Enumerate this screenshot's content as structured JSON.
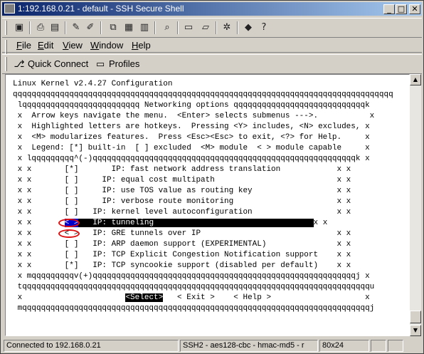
{
  "window": {
    "title": "1:192.168.0.21 - default - SSH Secure Shell",
    "minimize": "_",
    "maximize": "□",
    "close": "✕"
  },
  "toolbar": {
    "icons": [
      "save-icon",
      "print-icon",
      "print-preview-icon",
      "disconnect-icon",
      "connect-icon",
      "copy-icon",
      "paste-icon",
      "paste-alt-icon",
      "find-icon",
      "new-terminal-icon",
      "new-file-transfer-icon",
      "settings-icon",
      "help-book-icon",
      "context-help-icon"
    ],
    "glyphs": {
      "save": "▣",
      "print": "⎙",
      "preview": "▤",
      "disconnect": "✎",
      "connect": "✐",
      "copy": "⧉",
      "paste": "▦",
      "paste2": "▥",
      "find": "⌕",
      "terminal": "▭",
      "sftp": "▱",
      "settings": "✲",
      "book": "◆",
      "help": "?"
    }
  },
  "menu": {
    "items": [
      {
        "key": "F",
        "rest": "ile"
      },
      {
        "key": "E",
        "rest": "dit"
      },
      {
        "key": "V",
        "rest": "iew"
      },
      {
        "key": "W",
        "rest": "indow"
      },
      {
        "key": "H",
        "rest": "elp"
      }
    ]
  },
  "links": {
    "quick_connect": "Quick Connect",
    "profiles": "Profiles",
    "quick_glyph": "⎇",
    "profiles_glyph": "▭"
  },
  "terminal": {
    "l01": "Linux Kernel v2.4.27 Configuration",
    "l02": "qqqqqqqqqqqqqqqqqqqqqqqqqqqqqqqqqqqqqqqqqqqqqqqqqqqqqqqqqqqqqqqqqqqqqqqqqqqqqqqqq",
    "l03": " lqqqqqqqqqqqqqqqqqqqqqqqqq Networking options qqqqqqqqqqqqqqqqqqqqqqqqqqqqk",
    "l04": " x  Arrow keys navigate the menu.  <Enter> selects submenus --->.           x",
    "l05": " x  Highlighted letters are hotkeys.  Pressing <Y> includes, <N> excludes, x",
    "l06": " x  <M> modularizes features.  Press <Esc><Esc> to exit, <?> for Help.     x",
    "l07": " x  Legend: [*] built-in  [ ] excluded  <M> module  < > module capable     x",
    "l08": " x lqqqqqqqqq^(-)qqqqqqqqqqqqqqqqqqqqqqqqqqqqqqqqqqqqqqqqqqqqqqqqqqqqqqqqk x",
    "l09": " x x       [*]       IP: fast network address translation            x x",
    "l10": " x x       [ ]     IP: equal cost multipath                          x x",
    "l11": " x x       [ ]     IP: use TOS value as routing key                  x x",
    "l12": " x x       [ ]     IP: verbose route monitoring                      x x",
    "l13": " x x       [ ]   IP: kernel level autoconfiguration                  x x",
    "l14_pre": " x x       ",
    "l14_sel": "< >",
    "l14_text": "   IP: tunneling                                  ",
    "l14_post": "x x",
    "l15": " x x       < >   IP: GRE tunnels over IP                             x x",
    "l16": " x x       [ ]   IP: ARP daemon support (EXPERIMENTAL)               x x",
    "l17": " x x       [ ]   IP: TCP Explicit Congestion Notification support    x x",
    "l18": " x x       [*]   IP: TCP syncookie support (disabled per default)    x x",
    "l19": " x mqqqqqqqqqv(+)qqqqqqqqqqqqqqqqqqqqqqqqqqqqqqqqqqqqqqqqqqqqqqqqqqqqqqqqj x",
    "l20": " tqqqqqqqqqqqqqqqqqqqqqqqqqqqqqqqqqqqqqqqqqqqqqqqqqqqqqqqqqqqqqqqqqqqqqqqqqqu",
    "l21_pre": " x                      ",
    "l21_select": "<Select>",
    "l21_mid": "   < Exit >    < Help >                    ",
    "l21_post": "x",
    "l22": " mqqqqqqqqqqqqqqqqqqqqqqqqqqqqqqqqqqqqqqqqqqqqqqqqqqqqqqqqqqqqqqqqqqqqqqqqqqj"
  },
  "scrollbar": {
    "up": "▲",
    "down": "▼"
  },
  "status": {
    "connection": "Connected to 192.168.0.21",
    "cipher": "SSH2 - aes128-cbc - hmac-md5 - r",
    "size": "80x24"
  },
  "colors": {
    "selection_box": "#0000cc",
    "annotation_ring": "#dd1111",
    "title_start": "#0a246a"
  }
}
